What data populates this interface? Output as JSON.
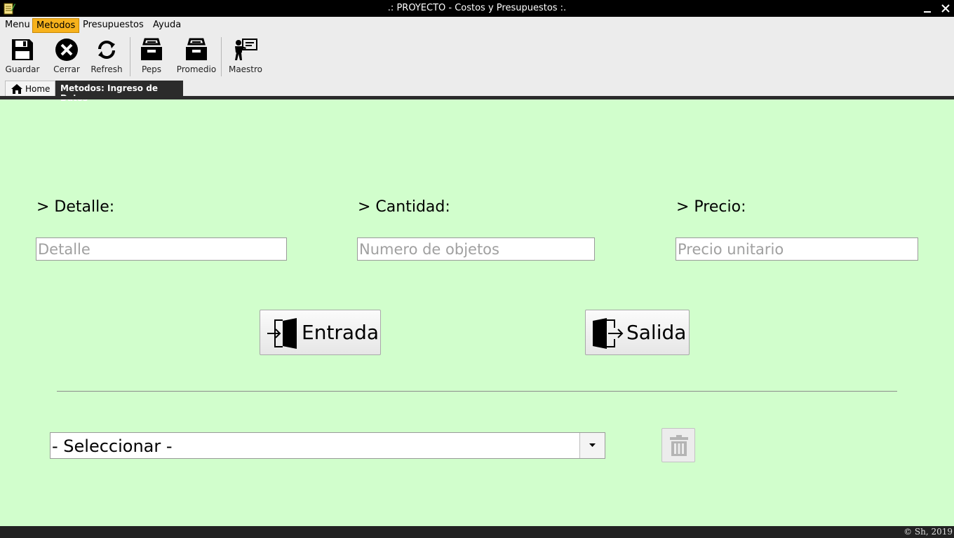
{
  "window": {
    "title": ".: PROYECTO - Costos y Presupuestos :.",
    "minimize_glyph": "—",
    "close_glyph": "✕"
  },
  "menubar": {
    "items": [
      {
        "label": "Menu"
      },
      {
        "label": "Metodos",
        "active": true
      },
      {
        "label": "Presupuestos"
      },
      {
        "label": "Ayuda"
      }
    ]
  },
  "toolbar": {
    "items": [
      {
        "label": "Guardar",
        "icon": "save-icon"
      },
      {
        "label": "Cerrar",
        "icon": "close-circle-icon"
      },
      {
        "label": "Refresh",
        "icon": "refresh-icon"
      },
      {
        "label": "Peps",
        "icon": "archive-tray-icon"
      },
      {
        "label": "Promedio",
        "icon": "archive-tray-icon"
      },
      {
        "label": "Maestro",
        "icon": "teacher-board-icon"
      }
    ]
  },
  "tabs": [
    {
      "label": "Home",
      "icon": "home-icon"
    },
    {
      "label": "Metodos: Ingreso de Datos",
      "active": true
    }
  ],
  "form": {
    "detalle": {
      "label": "> Detalle:",
      "placeholder": "Detalle",
      "value": ""
    },
    "cantidad": {
      "label": "> Cantidad:",
      "placeholder": "Numero de objetos",
      "value": ""
    },
    "precio": {
      "label": "> Precio:",
      "placeholder": "Precio unitario",
      "value": ""
    }
  },
  "actions": {
    "entrada": {
      "label": "Entrada",
      "icon": "door-enter-icon"
    },
    "salida": {
      "label": "Salida",
      "icon": "door-exit-icon"
    }
  },
  "selector": {
    "value": "- Seleccionar -"
  },
  "trash": {
    "icon": "trash-icon",
    "enabled": false
  },
  "status": {
    "copyright": "© Sh, 2019"
  },
  "colors": {
    "background": "#d1fecc",
    "menu_active": "#f7b21c",
    "titlebar": "#000000",
    "tab_active": "#2b2b2b"
  }
}
